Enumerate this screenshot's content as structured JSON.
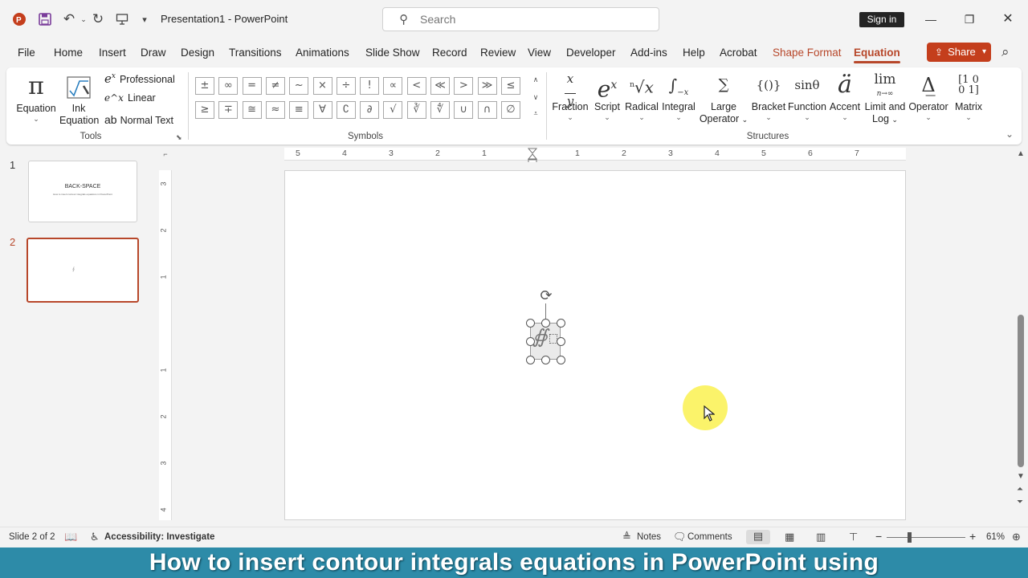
{
  "titlebar": {
    "document_title": "Presentation1  -  PowerPoint",
    "search_placeholder": "Search",
    "signin_label": "Sign in"
  },
  "tabs": [
    {
      "label": "File"
    },
    {
      "label": "Home"
    },
    {
      "label": "Insert"
    },
    {
      "label": "Draw"
    },
    {
      "label": "Design"
    },
    {
      "label": "Transitions"
    },
    {
      "label": "Animations"
    },
    {
      "label": "Slide Show"
    },
    {
      "label": "Record"
    },
    {
      "label": "Review"
    },
    {
      "label": "View"
    },
    {
      "label": "Developer"
    },
    {
      "label": "Add-ins"
    },
    {
      "label": "Help"
    },
    {
      "label": "Acrobat"
    },
    {
      "label": "Shape Format"
    },
    {
      "label": "Equation"
    }
  ],
  "share_label": "Share",
  "ribbon": {
    "tools": {
      "group_label": "Tools",
      "equation_label": "Equation",
      "ink_label_1": "Ink",
      "ink_label_2": "Equation",
      "professional_label": "Professional",
      "linear_label": "Linear",
      "normal_text_label": "Normal Text"
    },
    "symbols": {
      "group_label": "Symbols",
      "row1": [
        "±",
        "∞",
        "=",
        "≠",
        "~",
        "×",
        "÷",
        "!",
        "∝",
        "<",
        "≪",
        ">",
        "≫",
        "≤"
      ],
      "row2": [
        "≥",
        "∓",
        "≅",
        "≈",
        "≡",
        "∀",
        "∁",
        "∂",
        "√",
        "∛",
        "∜",
        "∪",
        "∩",
        "∅"
      ]
    },
    "structures": {
      "group_label": "Structures",
      "fraction": "Fraction",
      "script": "Script",
      "radical": "Radical",
      "integral": "Integral",
      "large_operator_1": "Large",
      "large_operator_2": "Operator",
      "bracket": "Bracket",
      "function": "Function",
      "accent": "Accent",
      "limit_1": "Limit and",
      "limit_2": "Log",
      "operator": "Operator",
      "matrix": "Matrix"
    }
  },
  "slides": {
    "slide1_number": "1",
    "slide1_title": "BACK-SPACE",
    "slide1_subtitle": "How to insert contour integrals equations in PowerPoint",
    "slide2_number": "2"
  },
  "ruler": {
    "h_ticks": [
      "5",
      "4",
      "3",
      "2",
      "1",
      "1",
      "2",
      "3",
      "4",
      "5",
      "6",
      "7"
    ],
    "v_ticks": [
      "3",
      "2",
      "1",
      "1",
      "2",
      "3",
      "4"
    ]
  },
  "statusbar": {
    "slide_info": "Slide 2 of 2",
    "accessibility": "Accessibility: Investigate",
    "notes": "Notes",
    "comments": "Comments",
    "zoom": "61%"
  },
  "caption": "How to insert contour integrals equations in PowerPoint using",
  "colors": {
    "accent": "#b7472a",
    "share_bg": "#c43e1c",
    "caption_bg": "#2d8ba8",
    "cursor_highlight": "#fbf25a"
  }
}
